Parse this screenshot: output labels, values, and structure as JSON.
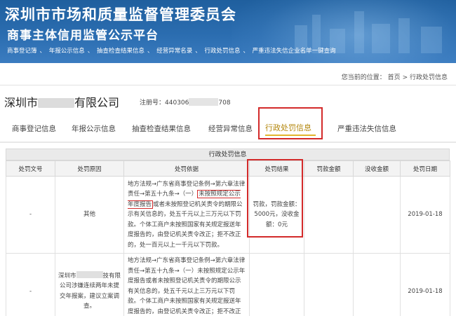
{
  "header": {
    "title": "深圳市市场和质量监督管理委员会",
    "subtitle": "商事主体信用监管公示平台",
    "nav": [
      "商事登记簿",
      "年报公示信息",
      "抽查检查结果信息",
      "经营异常名录",
      "行政处罚信息",
      "严重违法失信企业名单一键查询"
    ]
  },
  "breadcrumb": {
    "label": "您当前的位置：",
    "home": "首页",
    "sep": ">",
    "current": "行政处罚信息"
  },
  "company": {
    "prefix": "深圳市",
    "suffix": "有限公司",
    "reg_label": "注册号：",
    "reg_prefix": "440306",
    "reg_suffix": "708"
  },
  "tabs": [
    "商事登记信息",
    "年报公示信息",
    "抽查检查结果信息",
    "经营异常信息",
    "行政处罚信息",
    "严重违法失信信息"
  ],
  "active_tab": "行政处罚信息",
  "table": {
    "title": "行政处罚信息",
    "headers": [
      "处罚文号",
      "处罚原因",
      "处罚依据",
      "处罚结果",
      "罚款金额",
      "没收金额",
      "处罚日期"
    ],
    "rows": [
      {
        "doc_no": "-",
        "reason": "其他",
        "basis_a": "地方法规→广东省商事登记条例→第六章法律责任→第五十九条→（一）",
        "basis_hl": "未按照规定公示年度报告",
        "basis_b": "或者未按照登记机关责令的期限公示有关信息的，处五千元以上三万元以下罚款。个体工商户未按照国家有关规定报送年度报告的，由登记机关责令改正；拒不改正的，处一百元以上一千元以下罚款。",
        "result": "罚款，罚款金额：5000元，没收金额：0元",
        "fine": "",
        "confiscated": "",
        "date": "2019-01-18"
      },
      {
        "doc_no": "-",
        "reason_a": "深圳市",
        "reason_b": "技有限公司涉嫌连续两年未提交年报案，建议立案调查。",
        "basis": "地方法规→广东省商事登记条例→第六章法律责任→第五十九条→（一）未按照规定公示年度报告或者未按照登记机关责令的期限公示有关信息的，处五千元以上三万元以下罚款。个体工商户未按照国家有关规定报送年度报告的，由登记机关责令改正；拒不改正的，处一百元以上一千元以下罚款。",
        "result": "",
        "fine": "",
        "confiscated": "",
        "date": "2019-01-18"
      }
    ]
  },
  "colors": {
    "banner": "#2b6db0",
    "highlight": "#d32a2a",
    "active_tab_text": "#b3860b",
    "active_tab_underline": "#e2b52c"
  }
}
